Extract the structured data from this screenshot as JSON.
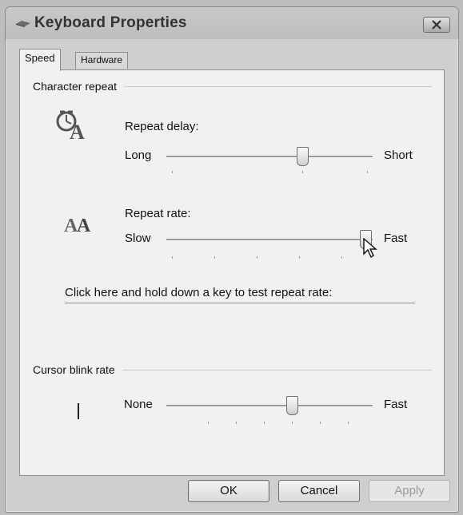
{
  "window": {
    "title": "Keyboard Properties",
    "close_icon": "close-icon"
  },
  "tabs": [
    {
      "label": "Speed",
      "selected": true
    },
    {
      "label": "Hardware",
      "selected": false
    }
  ],
  "character_repeat": {
    "group_label": "Character repeat",
    "repeat_delay": {
      "label": "Repeat delay:",
      "left_label": "Long",
      "right_label": "Short",
      "value_fraction": 0.65
    },
    "repeat_rate": {
      "label": "Repeat rate:",
      "left_label": "Slow",
      "right_label": "Fast",
      "value_fraction": 1.0
    },
    "test_label": "Click here and hold down a key to test repeat rate:"
  },
  "cursor_blink": {
    "group_label": "Cursor blink rate",
    "left_label": "None",
    "right_label": "Fast",
    "value_fraction": 0.6
  },
  "buttons": {
    "ok": "OK",
    "cancel": "Cancel",
    "apply": "Apply"
  }
}
